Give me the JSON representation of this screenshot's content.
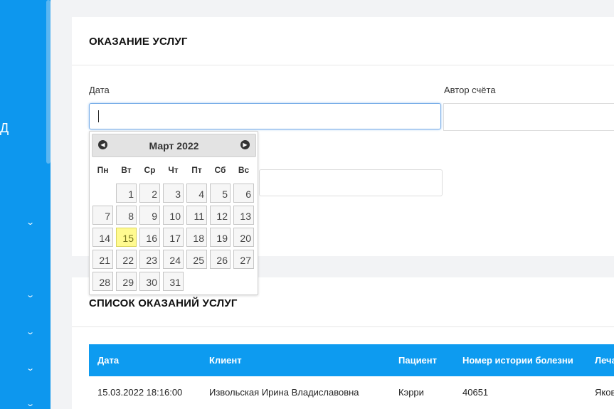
{
  "sidebar": {
    "letter": "Д"
  },
  "form_card": {
    "title": "ОКАЗАНИЕ УСЛУГ",
    "date_label": "Дата",
    "date_value": "",
    "author_label": "Автор счёта"
  },
  "datepicker": {
    "month_title": "Март 2022",
    "weekdays": [
      "Пн",
      "Вт",
      "Ср",
      "Чт",
      "Пт",
      "Сб",
      "Вс"
    ],
    "start_offset": 1,
    "days": [
      "1",
      "2",
      "3",
      "4",
      "5",
      "6",
      "7",
      "8",
      "9",
      "10",
      "11",
      "12",
      "13",
      "14",
      "15",
      "16",
      "17",
      "18",
      "19",
      "20",
      "21",
      "22",
      "23",
      "24",
      "25",
      "26",
      "27",
      "28",
      "29",
      "30",
      "31"
    ],
    "today": "15",
    "colors": {
      "today_bg": "#fffa90",
      "day_bg": "#f6f6f6"
    }
  },
  "list_card": {
    "title": "СПИСОК ОКАЗАНИЙ УСЛУГ",
    "columns": [
      "Дата",
      "Клиент",
      "Пациент",
      "Номер истории болезни",
      "Леча"
    ],
    "rows": [
      [
        "15.03.2022 18:16:00",
        "Извольская Ирина Владиславовна",
        "Кэрри",
        "40651",
        "Яков"
      ]
    ]
  },
  "colors": {
    "accent": "#0d97ee",
    "header_bg": "#0d9bf0"
  }
}
